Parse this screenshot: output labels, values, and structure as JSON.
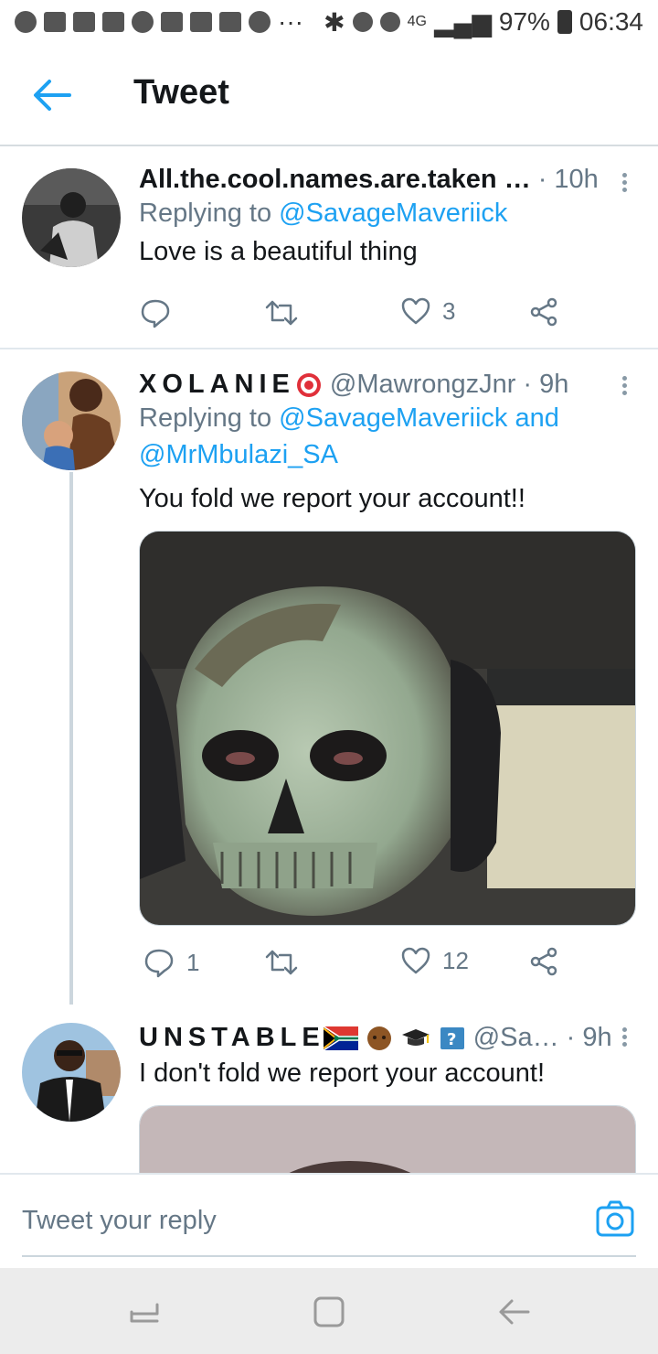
{
  "status_bar": {
    "network": "4G",
    "battery": "97%",
    "time": "06:34",
    "overflow": "···"
  },
  "header": {
    "title": "Tweet",
    "back_icon": "arrow-left-icon"
  },
  "tweets": [
    {
      "name": "All.the.cool.names.are.taken …",
      "handle": "",
      "time": "· 10h",
      "reply_prefix": "Replying to ",
      "reply_to": "@SavageMaveriick",
      "reply_to_2": "",
      "text": "Love is a beautiful thing",
      "replies": "",
      "retweets": "",
      "likes": "3"
    },
    {
      "name": "XOLANIE",
      "handle": "@MawrongzJnr",
      "time": "· 9h",
      "reply_prefix": "Replying to ",
      "reply_to": "@SavageMaveriick",
      "reply_join": " and",
      "reply_to_2": "@MrMbulazi_SA",
      "text": "You fold we report your account!!",
      "replies": "1",
      "retweets": "",
      "likes": "12"
    },
    {
      "name": "UNSTABLE",
      "handle": "@Sa…",
      "time": "· 9h",
      "text": "I don't fold we report your account!"
    }
  ],
  "compose": {
    "placeholder": "Tweet your reply"
  },
  "colors": {
    "accent": "#1da1f2",
    "muted": "#657786",
    "text": "#14171a"
  }
}
